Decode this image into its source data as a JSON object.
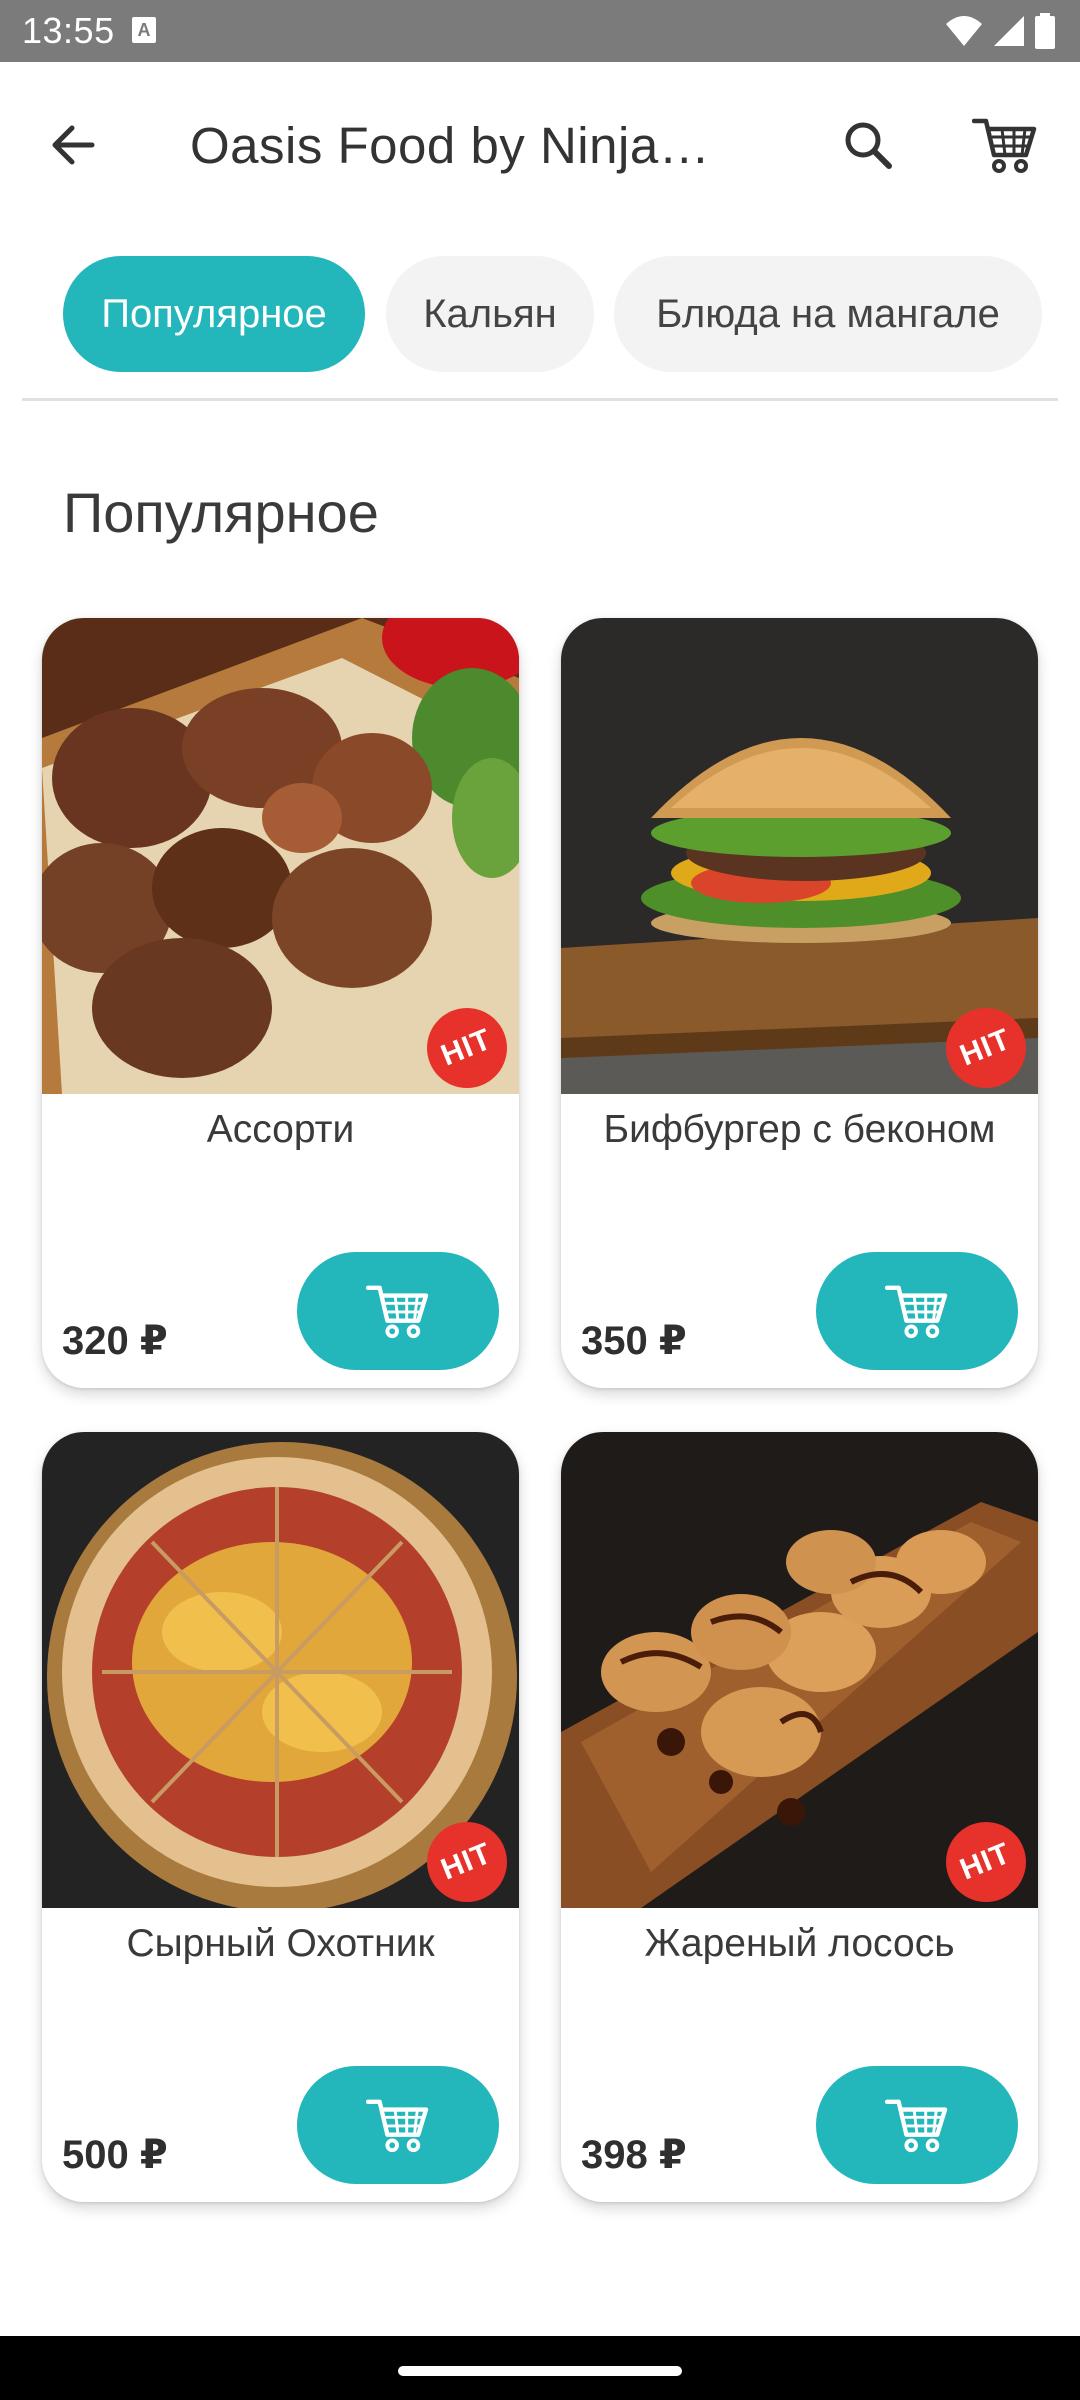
{
  "status_bar": {
    "time": "13:55",
    "notification_glyph": "A",
    "icons": [
      "wifi-icon",
      "signal-icon",
      "battery-icon"
    ]
  },
  "app_bar": {
    "title": "Oasis Food by Ninja…",
    "icons": [
      "arrow-left-icon",
      "search-icon",
      "cart-icon"
    ]
  },
  "tabs": [
    {
      "label": "Популярное",
      "active": true
    },
    {
      "label": "Кальян",
      "active": false
    },
    {
      "label": "Блюда на мангале",
      "active": false
    }
  ],
  "section": {
    "title": "Популярное"
  },
  "products": [
    {
      "name": "Ассорти",
      "price": "320 ₽",
      "badge": "HIT",
      "image": "grilled-meat-assortment"
    },
    {
      "name": "Бифбургер с беконом",
      "price": "350 ₽",
      "badge": "HIT",
      "image": "beef-burger"
    },
    {
      "name": "Сырный Охотник",
      "price": "500 ₽",
      "badge": "HIT",
      "image": "cheese-pizza"
    },
    {
      "name": "Жареный лосось",
      "price": "398 ₽",
      "badge": "HIT",
      "image": "fried-salmon-rolls"
    }
  ],
  "colors": {
    "accent": "#23b6bb",
    "badge": "#e7312b",
    "status_bar": "#7b7b7b",
    "chip_inactive": "#f3f3f3"
  }
}
